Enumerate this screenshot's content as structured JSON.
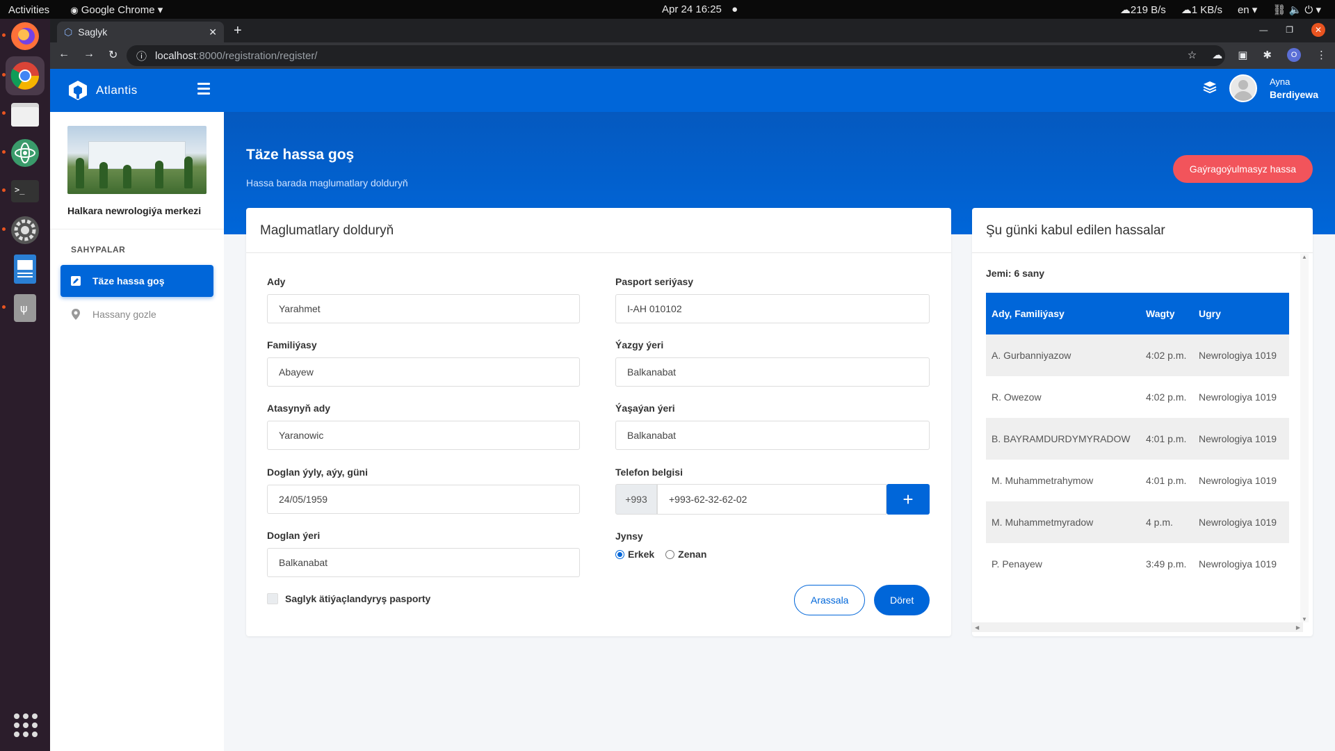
{
  "os_bar": {
    "activities": "Activities",
    "app_name": "Google Chrome",
    "datetime": "Apr 24  16:25",
    "net_down": "219 B/s",
    "net_up": "1 KB/s",
    "lang": "en"
  },
  "browser": {
    "tab_title": "Saglyk",
    "url_host": "localhost",
    "url_path": ":8000/registration/register/",
    "profile_initial": "O"
  },
  "app": {
    "brand": "Atlantis",
    "hospital_name": "Halkara newrologiýa merkezi",
    "sidebar_heading": "SAHYPALAR",
    "sidebar_items": [
      {
        "label": "Täze hassa goş",
        "icon": "edit-icon"
      },
      {
        "label": "Hassany gozle",
        "icon": "location-pin-icon"
      }
    ],
    "user": {
      "first_name": "Ayna",
      "last_name": "Berdiyewa"
    }
  },
  "banner": {
    "title": "Täze hassa goş",
    "subtitle": "Hassa barada maglumatlary dolduryň",
    "emergency_button": "Gaýragoýulmasyz hassa"
  },
  "form": {
    "card_title": "Maglumatlary dolduryň",
    "fields": {
      "first_name": {
        "label": "Ady",
        "value": "Yarahmet"
      },
      "last_name": {
        "label": "Familiýasy",
        "value": "Abayew"
      },
      "father_name": {
        "label": "Atasynyň ady",
        "value": "Yaranowic"
      },
      "birth_date": {
        "label": "Doglan ýyly, aýy, güni",
        "value": "24/05/1959"
      },
      "birth_place": {
        "label": "Doglan ýeri",
        "value": "Balkanabat"
      },
      "passport": {
        "label": "Pasport seriýasy",
        "value": "I-AH 010102"
      },
      "registered_place": {
        "label": "Ýazgy ýeri",
        "value": "Balkanabat"
      },
      "living_place": {
        "label": "Ýaşaýan ýeri",
        "value": "Balkanabat"
      },
      "phone": {
        "label": "Telefon belgisi",
        "prefix": "+993",
        "value": "+993-62-32-62-02",
        "add_button": "+"
      }
    },
    "gender": {
      "label": "Jynsy",
      "options": [
        "Erkek",
        "Zenan"
      ],
      "selected": "Erkek"
    },
    "insurance_checkbox": {
      "label": "Saglyk ätiýaçlandyryş pasporty",
      "checked": false
    },
    "clear_button": "Arassala",
    "create_button": "Döret"
  },
  "today_list": {
    "card_title": "Şu günki kabul edilen hassalar",
    "total": "Jemi: 6 sany",
    "columns": [
      "Ady, Familiýasy",
      "Wagty",
      "Ugry"
    ],
    "rows": [
      [
        "A. Gurbanniyazow",
        "4:02 p.m.",
        "Newrologiya 1019"
      ],
      [
        "R. Owezow",
        "4:02 p.m.",
        "Newrologiya 1019"
      ],
      [
        "B. BAYRAMDURDYMYRADOW",
        "4:01 p.m.",
        "Newrologiya 1019"
      ],
      [
        "M. Muhammetrahymow",
        "4:01 p.m.",
        "Newrologiya 1019"
      ],
      [
        "M. Muhammetmyradow",
        "4 p.m.",
        "Newrologiya 1019"
      ],
      [
        "P. Penayew",
        "3:49 p.m.",
        "Newrologiya 1019"
      ]
    ]
  },
  "colors": {
    "primary": "#0066d9",
    "danger": "#f2545b",
    "row_shade": "#efefef"
  }
}
